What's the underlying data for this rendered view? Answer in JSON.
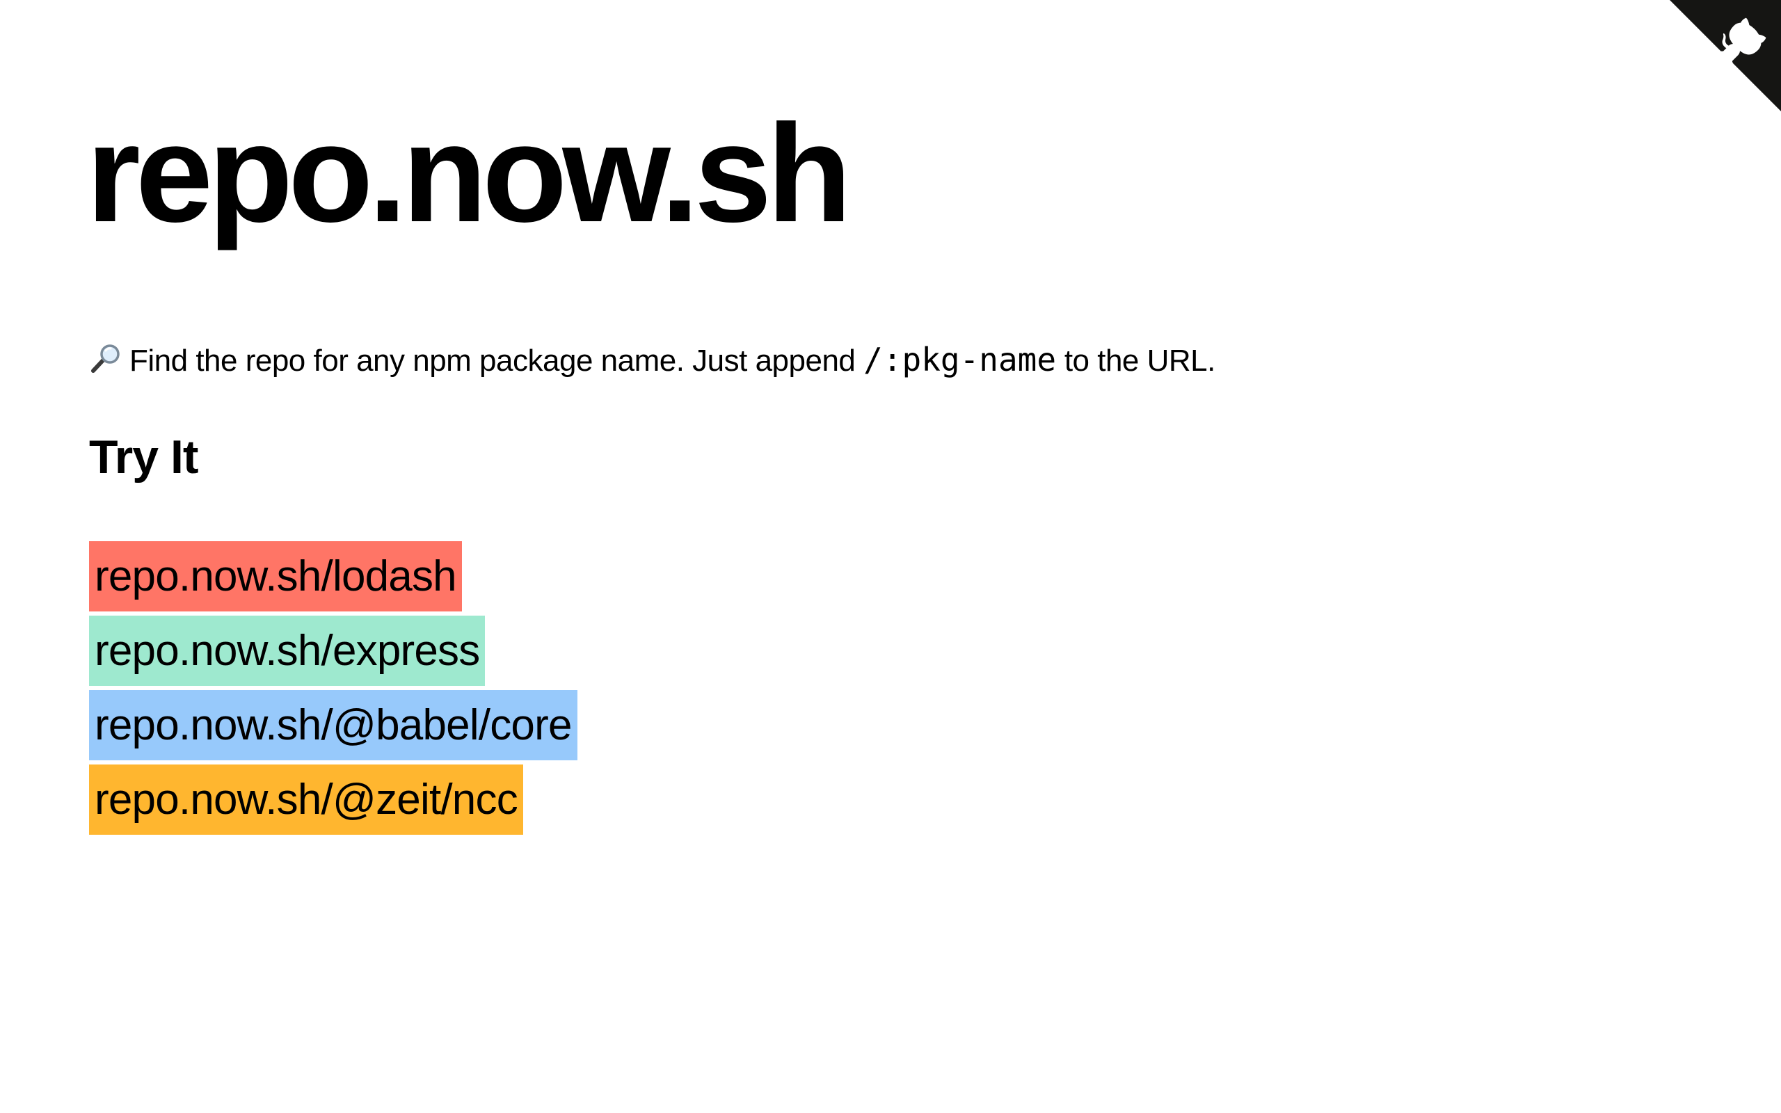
{
  "corner": {
    "icon": "github-octocat-icon",
    "color": "#151513"
  },
  "header": {
    "title": "repo.now.sh"
  },
  "intro": {
    "icon": "magnifying-glass-icon",
    "text_before": "Find the repo for any npm package name. Just append",
    "code": "/:pkg-name",
    "text_after": "to the URL."
  },
  "try_section": {
    "heading": "Try It",
    "links": [
      {
        "label": "repo.now.sh/lodash",
        "color": "#ff7566"
      },
      {
        "label": "repo.now.sh/express",
        "color": "#9ee9cf"
      },
      {
        "label": "repo.now.sh/@babel/core",
        "color": "#97c9fb"
      },
      {
        "label": "repo.now.sh/@zeit/ncc",
        "color": "#ffb62f"
      }
    ]
  }
}
